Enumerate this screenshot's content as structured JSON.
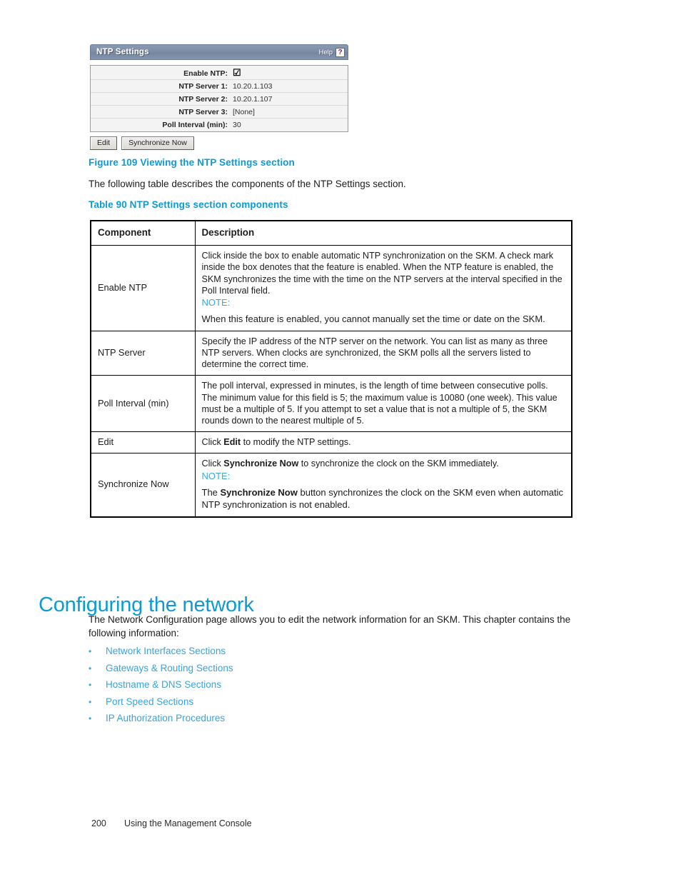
{
  "figure_screenshot": {
    "panel": {
      "title": "NTP Settings",
      "help_label": "Help",
      "help_icon_glyph": "?",
      "rows": [
        {
          "label": "Enable NTP:",
          "value": "",
          "control": "checkbox-checked"
        },
        {
          "label": "NTP Server 1:",
          "value": "10.20.1.103",
          "control": "text"
        },
        {
          "label": "NTP Server 2:",
          "value": "10.20.1.107",
          "control": "text"
        },
        {
          "label": "NTP Server 3:",
          "value": "[None]",
          "control": "text"
        },
        {
          "label": "Poll Interval (min):",
          "value": "30",
          "control": "text"
        }
      ],
      "buttons": [
        {
          "label": "Edit"
        },
        {
          "label": "Synchronize Now"
        }
      ]
    }
  },
  "figure_caption": "Figure 109 Viewing the NTP Settings section",
  "intro_paragraph": "The following table describes the components of the NTP Settings section.",
  "table_caption": "Table 90 NTP Settings section components",
  "components_table": {
    "headers": [
      "Component",
      "Description"
    ],
    "rows": [
      {
        "component": "Enable NTP",
        "description": "Click inside the box to enable automatic NTP synchronization on the SKM. A check mark inside the box denotes that the feature is enabled. When the NTP feature is enabled, the SKM synchronizes the time with the time on the NTP servers at the interval specified in the Poll Interval field.",
        "note_label": "NOTE:",
        "note_body": "When this feature is enabled, you cannot manually set the time or date on the SKM."
      },
      {
        "component": "NTP Server",
        "description": "Specify the IP address of the NTP server on the network. You can list as many as three NTP servers. When clocks are synchronized, the SKM polls all the servers listed to determine the correct time."
      },
      {
        "component": "Poll Interval (min)",
        "description": "The poll interval, expressed in minutes, is the length of time between consecutive polls. The minimum value for this field is 5; the maximum value is 10080 (one week). This value must be a multiple of 5. If you attempt to set a value that is not a multiple of 5, the SKM rounds down to the nearest multiple of 5."
      },
      {
        "component": "Edit",
        "description_parts": [
          {
            "text": "Click ",
            "bold": false
          },
          {
            "text": "Edit",
            "bold": true
          },
          {
            "text": " to modify the NTP settings.",
            "bold": false
          }
        ]
      },
      {
        "component": "Synchronize Now",
        "description_parts": [
          {
            "text": "Click ",
            "bold": false
          },
          {
            "text": "Synchronize Now",
            "bold": true
          },
          {
            "text": " to synchronize the clock on the SKM immediately.",
            "bold": false
          }
        ],
        "note_label": "NOTE:",
        "note_body_parts": [
          {
            "text": "The ",
            "bold": false
          },
          {
            "text": "Synchronize Now",
            "bold": true
          },
          {
            "text": " button synchronizes the clock on the SKM even when automatic NTP synchronization is not enabled.",
            "bold": false
          }
        ]
      }
    ]
  },
  "section": {
    "heading": "Configuring the network",
    "paragraph": "The Network Configuration page allows you to edit the network information for an SKM. This chapter contains the following information:",
    "links": [
      "Network Interfaces Sections",
      "Gateways & Routing Sections",
      "Hostname & DNS Sections",
      "Port Speed Sections",
      "IP Authorization Procedures"
    ],
    "bullet_glyph": "•"
  },
  "footer": {
    "page_number": "200",
    "running_title": "Using the Management Console"
  },
  "colors": {
    "accent_blue": "#0e9ad4",
    "link_blue": "#3aa3db",
    "note_blue": "#39a9dd",
    "panel_header": "#7e8ea9",
    "help_glyph": "#7a1f8f"
  }
}
